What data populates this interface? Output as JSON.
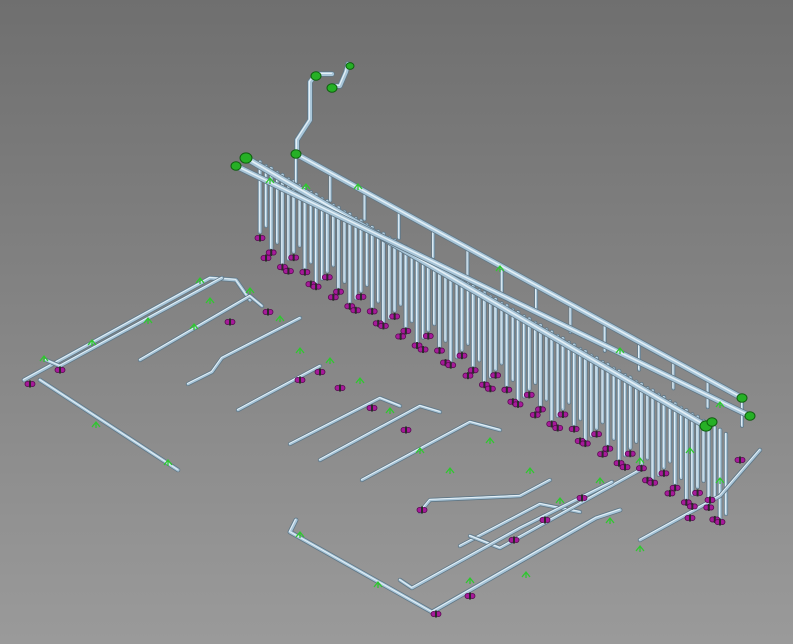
{
  "viewport": {
    "background_top": "#6f6f6f",
    "background_bottom": "#9a9a9a"
  },
  "colors": {
    "pipe": "#a9c6d9",
    "pipe_shadow": "#5f7685",
    "pipe_highlight": "#e4f0f7",
    "valve": "#a61a9a",
    "support": "#2ec82e",
    "flange": "#26b026"
  },
  "model": {
    "component_types": [
      "header-pipe",
      "drop-pipe",
      "branch-pipe",
      "valve",
      "pipe-support",
      "flange"
    ]
  }
}
